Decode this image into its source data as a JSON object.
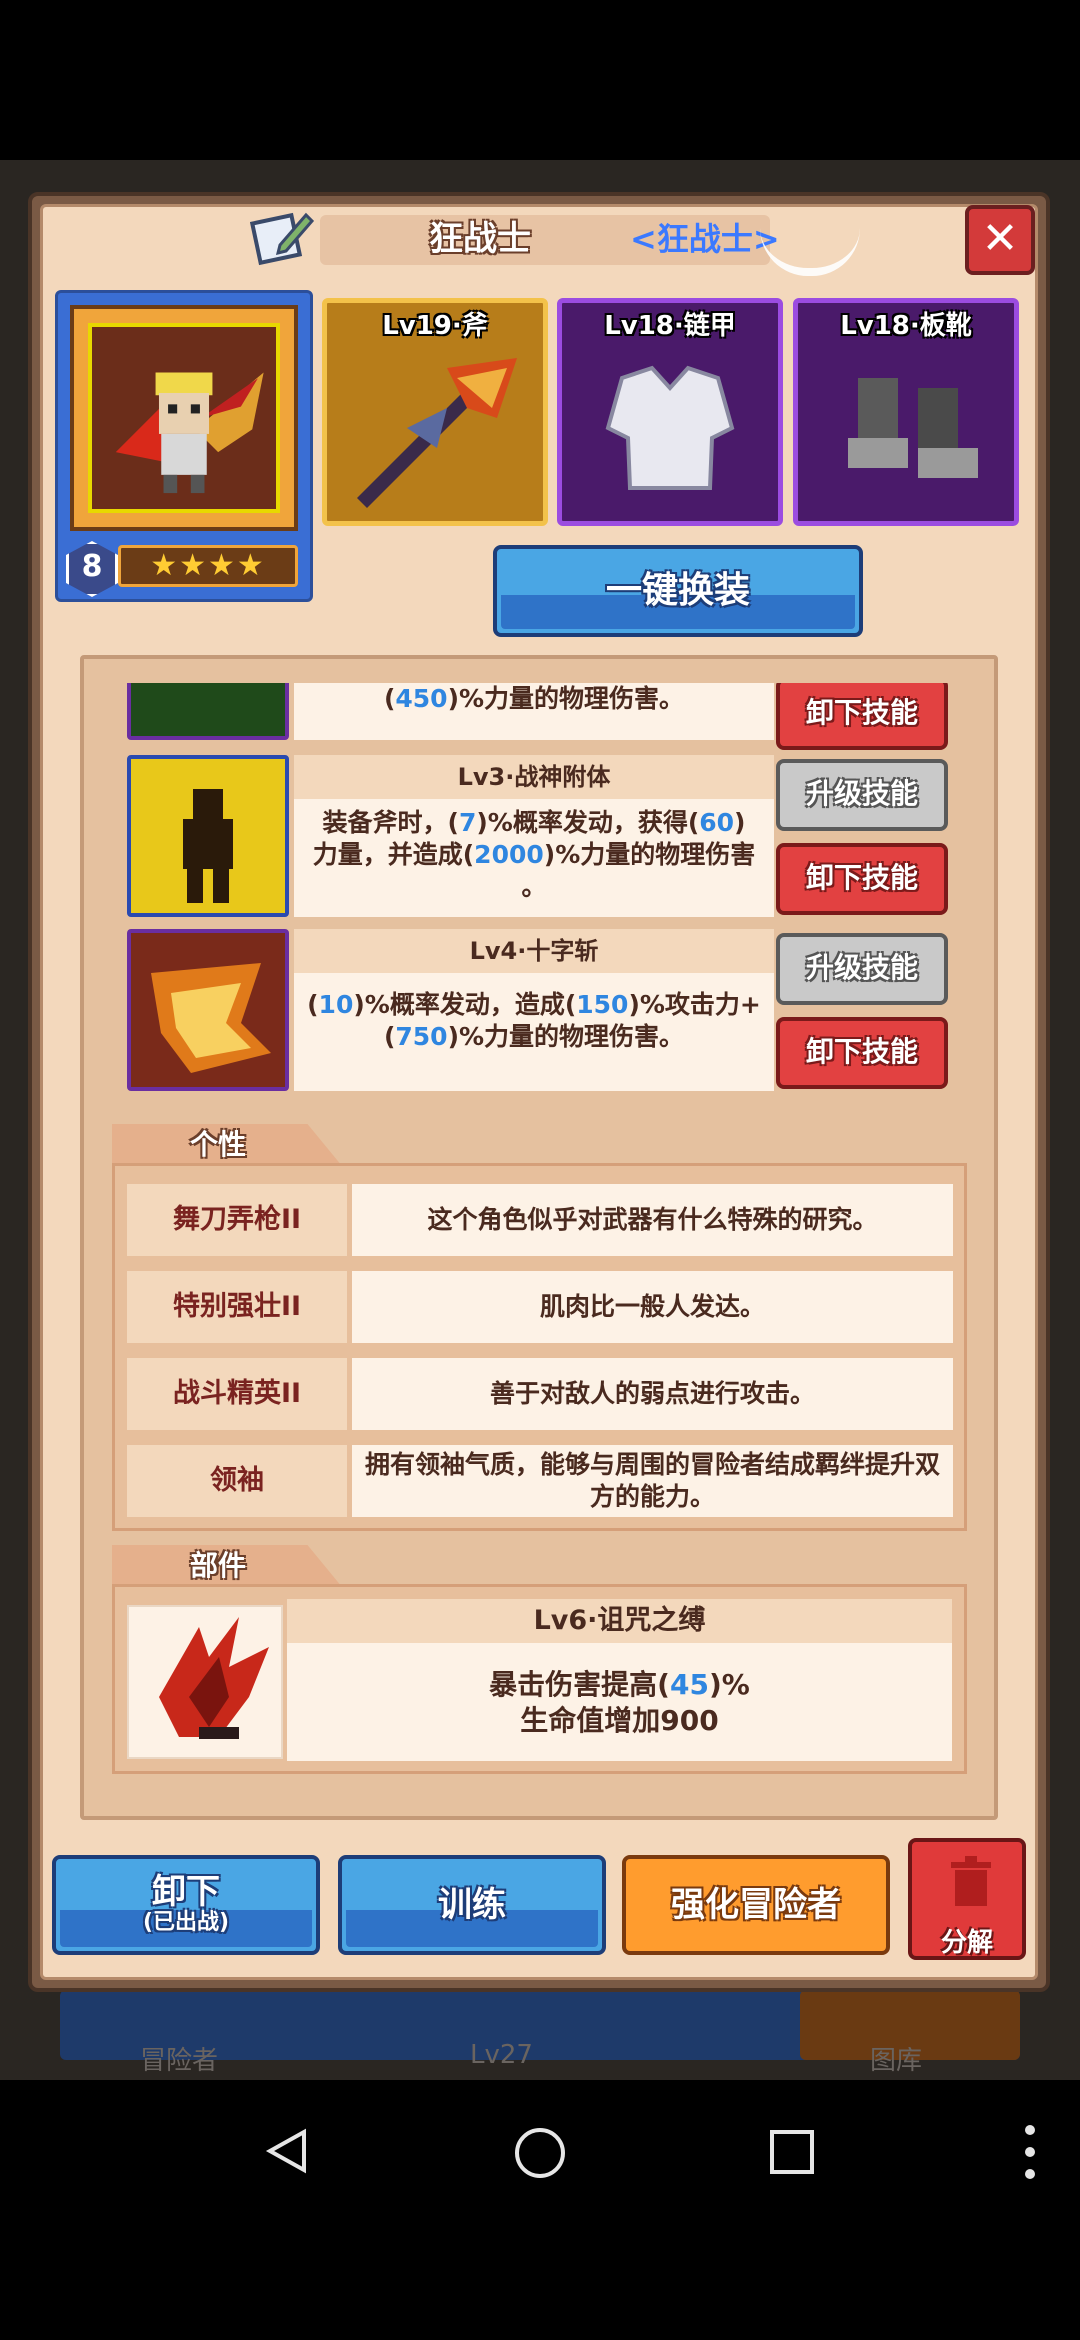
{
  "window": {
    "title": "狂战士",
    "subtitle": "<狂战士>",
    "close_label": "✕"
  },
  "hero": {
    "level": "8",
    "stars": "★★★★"
  },
  "equipment": [
    {
      "label": "Lv19·斧",
      "rarity": "gold",
      "icon": "axe-icon"
    },
    {
      "label": "Lv18·链甲",
      "rarity": "purple",
      "icon": "chainmail-icon"
    },
    {
      "label": "Lv18·板靴",
      "rarity": "purple",
      "icon": "boots-icon"
    }
  ],
  "actions": {
    "one_click_equip": "一键换装",
    "unload_label": "卸下",
    "unload_sub": "(已出战)",
    "train": "训练",
    "enhance": "强化冒险者",
    "dismantle": "分解"
  },
  "skills": [
    {
      "title": "",
      "desc_line1_parts": [
        "(",
        "450",
        ")%力量的物理伤害。"
      ],
      "upgrade_label": "",
      "unload_label": "卸下技能"
    },
    {
      "title": "Lv3·战神附体",
      "desc_line1_parts": [
        "装备斧时，(",
        "7",
        ")%概率发动，获得(",
        "60",
        ")"
      ],
      "desc_line2_parts": [
        "力量，并造成(",
        "2000",
        ")%力量的物理伤害"
      ],
      "desc_line3": "。",
      "upgrade_label": "升级技能",
      "unload_label": "卸下技能"
    },
    {
      "title": "Lv4·十字斩",
      "desc_line1_parts": [
        "(",
        "10",
        ")%概率发动，造成(",
        "150",
        ")%攻击力+"
      ],
      "desc_line2_parts": [
        "(",
        "750",
        ")%力量的物理伤害。"
      ],
      "upgrade_label": "升级技能",
      "unload_label": "卸下技能"
    }
  ],
  "traits_section": {
    "label": "个性",
    "items": [
      {
        "name": "舞刀弄枪II",
        "desc": "这个角色似乎对武器有什么特殊的研究。"
      },
      {
        "name": "特别强壮II",
        "desc": "肌肉比一般人发达。"
      },
      {
        "name": "战斗精英II",
        "desc": "善于对敌人的弱点进行攻击。"
      },
      {
        "name": "领袖",
        "desc": "拥有领袖气质，能够与周围的冒险者结成羁绊提升双方的能力。"
      }
    ]
  },
  "parts_section": {
    "label": "部件",
    "item": {
      "title": "Lv6·诅咒之缚",
      "desc_line1_parts": [
        "暴击伤害提高(",
        "45",
        ")%"
      ],
      "desc_line2": "生命值增加900"
    }
  },
  "background": {
    "left_text": "冒险者",
    "center_text": "Lv27",
    "right_text": "图库"
  },
  "colors": {
    "accent_blue": "#4aa6e4",
    "highlight_number": "#2f86e0",
    "danger_red": "#e24141",
    "orange": "#ff9c2e"
  }
}
